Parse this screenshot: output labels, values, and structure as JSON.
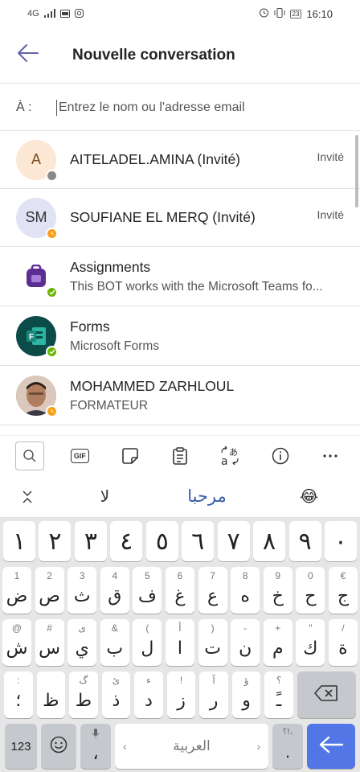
{
  "status_bar": {
    "network": "4G",
    "battery": "23",
    "time": "16:10"
  },
  "header": {
    "title": "Nouvelle conversation"
  },
  "to_field": {
    "label": "À :",
    "placeholder": "Entrez le nom ou l'adresse email"
  },
  "contacts": [
    {
      "initials": "A",
      "name": "AITELADEL.AMINA  (Invité)",
      "tag": "Invité",
      "avatar_bg": "#fde7d5",
      "avatar_fg": "#7a4a1c",
      "presence": "offline"
    },
    {
      "initials": "SM",
      "name": "SOUFIANE EL MERQ  (Invité)",
      "tag": "Invité",
      "avatar_bg": "#e1e3f5",
      "avatar_fg": "#333",
      "presence": "away"
    },
    {
      "name": "Assignments",
      "sub": "This BOT works with the Microsoft Teams fo...",
      "presence": "available"
    },
    {
      "name": "Forms",
      "sub": "Microsoft Forms",
      "presence": "available"
    },
    {
      "name": "MOHAMMED ZARHLOUL",
      "sub": "FORMATEUR",
      "presence": "away"
    }
  ],
  "keyboard": {
    "toolbar": [
      "search-icon",
      "gif-icon",
      "sticker-icon",
      "clipboard-icon",
      "translate-icon",
      "info-icon",
      "more-icon"
    ],
    "gif_label": "GIF",
    "suggestions": [
      "لا",
      "مرحبا",
      "😂"
    ],
    "number_row": [
      "١",
      "٢",
      "٣",
      "٤",
      "٥",
      "٦",
      "٧",
      "٨",
      "٩",
      "٠"
    ],
    "row1": [
      {
        "hint": "1",
        "key": "ض"
      },
      {
        "hint": "2",
        "key": "ص"
      },
      {
        "hint": "3",
        "key": "ث"
      },
      {
        "hint": "4",
        "key": "ق"
      },
      {
        "hint": "5",
        "key": "ف"
      },
      {
        "hint": "6",
        "key": "غ"
      },
      {
        "hint": "7",
        "key": "ع"
      },
      {
        "hint": "8",
        "key": "ه"
      },
      {
        "hint": "9",
        "key": "خ"
      },
      {
        "hint": "0",
        "key": "ح"
      },
      {
        "hint": "€",
        "key": "ج"
      }
    ],
    "row2": [
      {
        "hint": "@",
        "key": "ش"
      },
      {
        "hint": "#",
        "key": "س"
      },
      {
        "hint": "ى",
        "key": "ي"
      },
      {
        "hint": "&",
        "key": "ب"
      },
      {
        "hint": "(",
        "key": "ل"
      },
      {
        "hint": "أ",
        "key": "ا"
      },
      {
        "hint": ")",
        "key": "ت"
      },
      {
        "hint": "-",
        "key": "ن"
      },
      {
        "hint": "+",
        "key": "م"
      },
      {
        "hint": "\"",
        "key": "ك"
      },
      {
        "hint": "/",
        "key": "ة"
      }
    ],
    "row3": [
      {
        "hint": ":",
        "key": "؛"
      },
      {
        "hint": "",
        "key": "ظ"
      },
      {
        "hint": "گ",
        "key": "ط"
      },
      {
        "hint": "ئ",
        "key": "ذ"
      },
      {
        "hint": "ء",
        "key": "د"
      },
      {
        "hint": "!",
        "key": "ز"
      },
      {
        "hint": "آ",
        "key": "ر"
      },
      {
        "hint": "ؤ",
        "key": "و"
      },
      {
        "hint": "؟",
        "key": "ـً"
      }
    ],
    "key_123": "123",
    "comma_key": "،",
    "space_label": "العربية",
    "period_key": ".",
    "period_hint": "؟!،"
  },
  "colors": {
    "accent": "#6264a7",
    "enter": "#5276e5",
    "presence_available": "#6bb700",
    "presence_away": "#f8a01c",
    "presence_offline": "#8a8a8a"
  }
}
